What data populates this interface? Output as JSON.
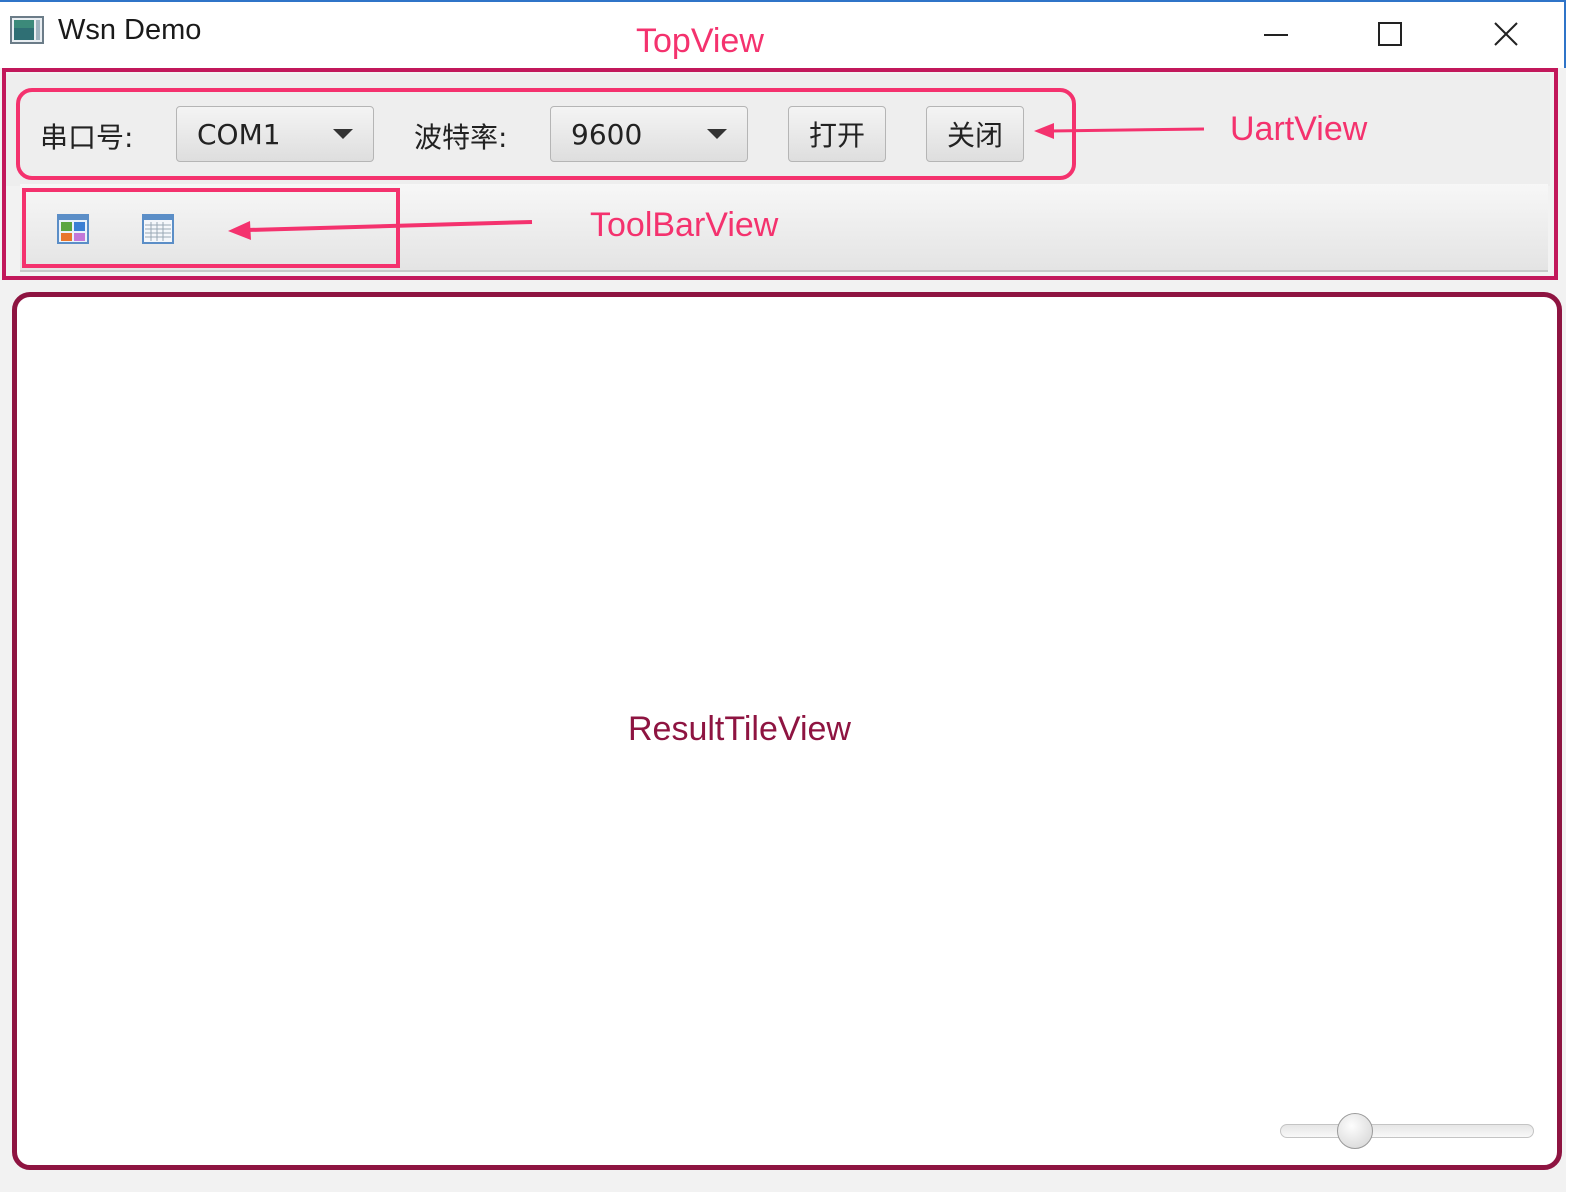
{
  "window": {
    "title": "Wsn Demo",
    "icons": {
      "app": "app-window-icon",
      "minimize": "minimize-icon",
      "maximize": "maximize-icon",
      "close": "close-icon"
    }
  },
  "uart": {
    "port_label": "串口号:",
    "port_value": "COM1",
    "baud_label": "波特率:",
    "baud_value": "9600",
    "open_label": "打开",
    "close_label": "关闭"
  },
  "toolbar": {
    "buttons": [
      {
        "icon": "tile-view-icon"
      },
      {
        "icon": "table-view-icon"
      }
    ]
  },
  "annotations": {
    "topview": "TopView",
    "uartview": "UartView",
    "toolbarview": "ToolBarView",
    "resulttileview": "ResultTileView"
  },
  "slider": {
    "value_fraction": 0.26
  },
  "colors": {
    "annotation_pink": "#f4326e",
    "annotation_crimson": "#c2185b",
    "annotation_maroon": "#8e1441",
    "window_border": "#2f74c8"
  }
}
